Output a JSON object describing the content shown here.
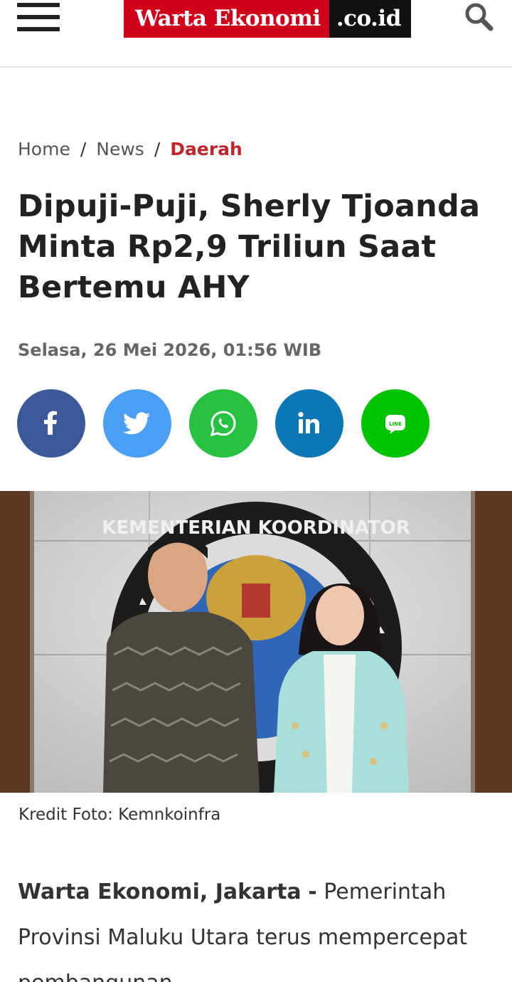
{
  "header": {
    "logo_main": "Warta Ekonomi",
    "logo_suffix": ".co.id",
    "menu_icon": "hamburger-menu-icon",
    "search_icon": "search-icon",
    "brand_red": "#d0011b",
    "brand_black": "#111111"
  },
  "breadcrumb": {
    "items": [
      "Home",
      "News"
    ],
    "separator": "/",
    "active": "Daerah",
    "active_color": "#c0262c"
  },
  "article": {
    "title": "Dipuji-Puji, Sherly Tjoanda Minta Rp2,9 Triliun Saat Bertemu AHY",
    "date": "Selasa, 26 Mei 2026, 01:56 WIB",
    "photo_credit": "Kredit Foto: Kemnkoinfra",
    "photo_emblem_text": "KEMENTERIAN KOORDINATOR",
    "lead_source": "Warta Ekonomi, Jakarta",
    "lead_dash": "-",
    "lead_text": "Pemerintah Provinsi Maluku Utara terus mempercepat pembangunan"
  },
  "share": {
    "buttons": [
      {
        "icon": "facebook-icon",
        "color": "#3b5998"
      },
      {
        "icon": "twitter-icon",
        "color": "#4a9ff5"
      },
      {
        "icon": "whatsapp-icon",
        "color": "#25c13f"
      },
      {
        "icon": "linkedin-icon",
        "color": "#0c77b5"
      },
      {
        "icon": "line-icon",
        "color": "#00c300"
      }
    ],
    "line_label": "LINE"
  }
}
